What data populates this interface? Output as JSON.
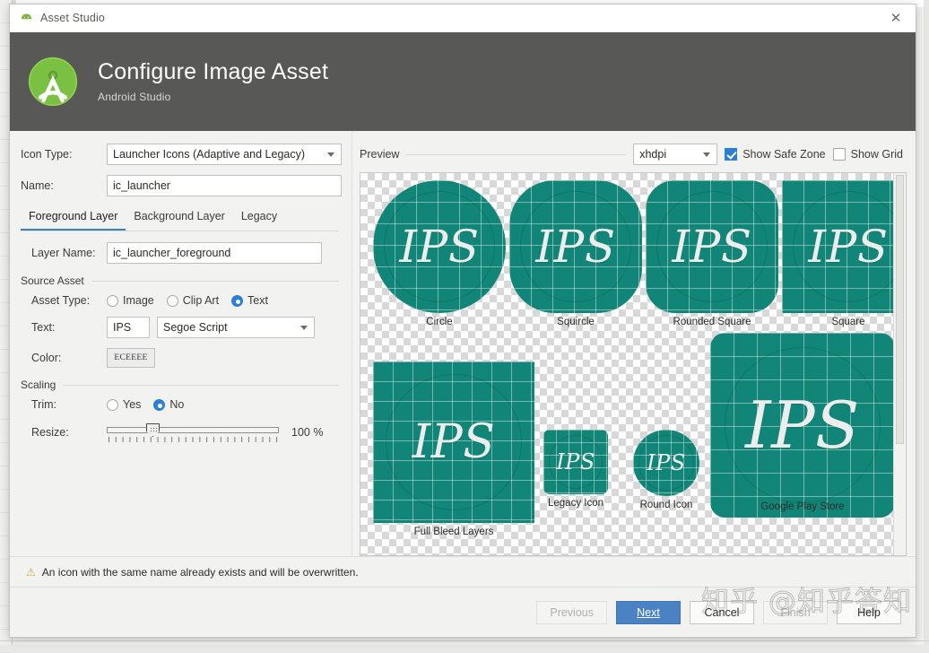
{
  "window": {
    "title": "Asset Studio",
    "title_icon": "android-icon",
    "close_icon": "close-icon"
  },
  "banner": {
    "logo_icon": "android-studio-logo-icon",
    "title": "Configure Image Asset",
    "subtitle": "Android Studio"
  },
  "form": {
    "icon_type": {
      "label": "Icon Type:",
      "value": "Launcher Icons (Adaptive and Legacy)"
    },
    "name": {
      "label": "Name:",
      "value": "ic_launcher"
    },
    "tabs": [
      {
        "label": "Foreground Layer",
        "active": true
      },
      {
        "label": "Background Layer",
        "active": false
      },
      {
        "label": "Legacy",
        "active": false
      }
    ],
    "layer_name": {
      "label": "Layer Name:",
      "value": "ic_launcher_foreground"
    },
    "source_asset": {
      "group_label": "Source Asset",
      "asset_type": {
        "label": "Asset Type:",
        "options": [
          {
            "label": "Image",
            "selected": false
          },
          {
            "label": "Clip Art",
            "selected": false
          },
          {
            "label": "Text",
            "selected": true
          }
        ]
      },
      "text": {
        "label": "Text:",
        "value": "IPS"
      },
      "font": {
        "value": "Segoe Script"
      },
      "color": {
        "label": "Color:",
        "value": "ECEEEE"
      }
    },
    "scaling": {
      "group_label": "Scaling",
      "trim": {
        "label": "Trim:",
        "options": [
          {
            "label": "Yes",
            "selected": false
          },
          {
            "label": "No",
            "selected": true
          }
        ]
      },
      "resize": {
        "label": "Resize:",
        "value": "100 %",
        "percent": 100
      }
    }
  },
  "preview": {
    "label": "Preview",
    "density": "xhdpi",
    "show_safe_zone": {
      "label": "Show Safe Zone",
      "checked": true
    },
    "show_grid": {
      "label": "Show Grid",
      "checked": false
    },
    "icon_text": "IPS",
    "icon_color": "#118577",
    "text_color": "#ECEEEE",
    "tiles": [
      {
        "caption": "Circle",
        "shape": "circle"
      },
      {
        "caption": "Squircle",
        "shape": "squircle"
      },
      {
        "caption": "Rounded Square",
        "shape": "rounded"
      },
      {
        "caption": "Square",
        "shape": "square"
      },
      {
        "caption": "Full Bleed Layers",
        "shape": "full"
      },
      {
        "caption": "Legacy Icon",
        "shape": "legacy"
      },
      {
        "caption": "Round Icon",
        "shape": "circle"
      },
      {
        "caption": "Google Play Store",
        "shape": "play"
      }
    ]
  },
  "warning": {
    "icon": "warning-triangle-icon",
    "message": "An icon with the same name already exists and will be overwritten."
  },
  "footer": {
    "previous": "Previous",
    "next": "Next",
    "cancel": "Cancel",
    "finish": "Finish",
    "help": "Help",
    "watermark": "知乎 @知乎答知"
  },
  "colors": {
    "accent_blue": "#4a82c4",
    "icon_teal": "#118577",
    "banner_gray": "#585856"
  }
}
